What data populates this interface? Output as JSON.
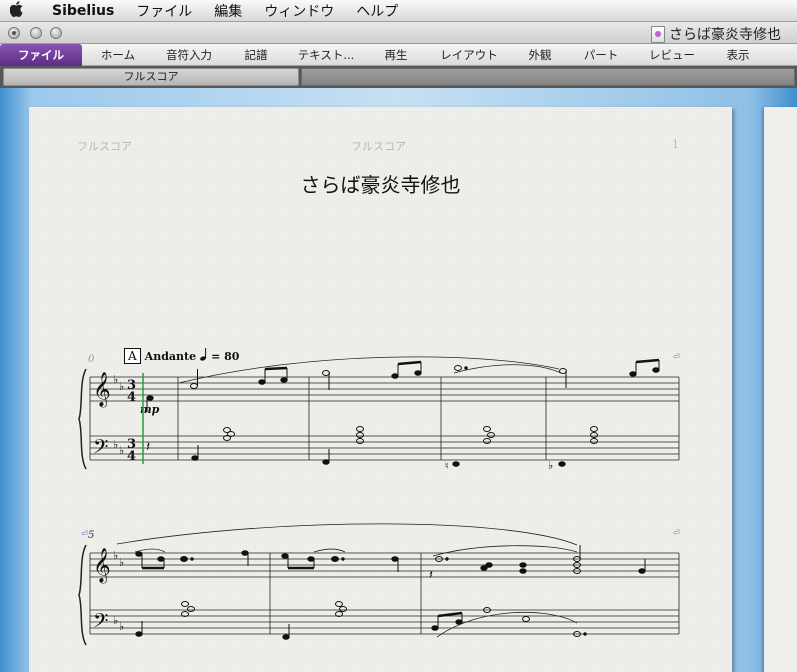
{
  "menubar": {
    "apple": "",
    "items": [
      "Sibelius",
      "ファイル",
      "編集",
      "ウィンドウ",
      "ヘルプ"
    ]
  },
  "window": {
    "title": "さらば豪炎寺修也"
  },
  "ribbon": {
    "tabs": [
      "ファイル",
      "ホーム",
      "音符入力",
      "記譜",
      "テキスト...",
      "再生",
      "レイアウト",
      "外観",
      "パート",
      "レビュー",
      "表示"
    ],
    "active_tab": "ファイル"
  },
  "score_tabs": {
    "active": "フルスコア"
  },
  "page": {
    "header_left": "フルスコア",
    "header_center": "フルスコア",
    "page_number": "1",
    "title": "さらば豪炎寺修也",
    "rehearsal_mark": "A",
    "tempo_text": "Andante",
    "tempo_value": "= 80",
    "bar_number_first": "0",
    "bar_number_second": "5",
    "dynamic": "mp"
  },
  "colors": {
    "ribbon_active": "#6a3a94",
    "workspace": "#9cc9ec",
    "paper": "#f1efec"
  }
}
